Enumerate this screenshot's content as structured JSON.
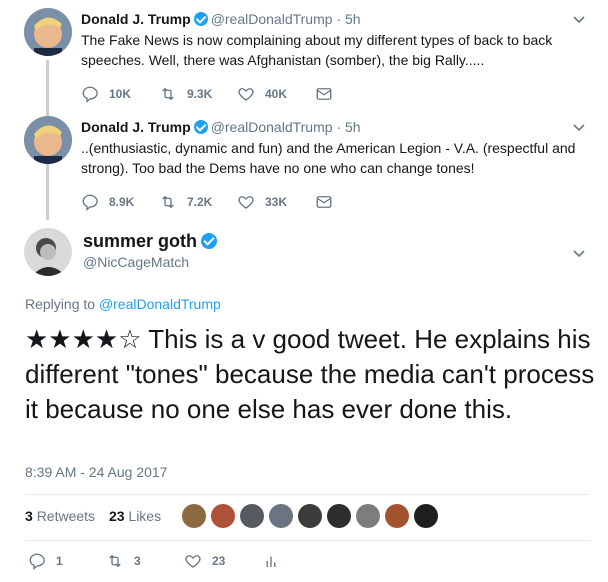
{
  "tweets": [
    {
      "name": "Donald J. Trump",
      "handle": "@realDonaldTrump",
      "time": "· 5h",
      "text": "The Fake News is now complaining about my different types of back to back speeches. Well, there was Afghanistan (somber), the big Rally.....",
      "replies": "10K",
      "retweets": "9.3K",
      "likes": "40K"
    },
    {
      "name": "Donald J. Trump",
      "handle": "@realDonaldTrump",
      "time": "· 5h",
      "text": "..(enthusiastic, dynamic and fun) and the American Legion - V.A. (respectful and strong). Too bad the Dems have no one who can change tones!",
      "replies": "8.9K",
      "retweets": "7.2K",
      "likes": "33K"
    }
  ],
  "main": {
    "name": "summer goth",
    "handle": "@NicCageMatch",
    "replying_prefix": "Replying to ",
    "replying_to": "@realDonaldTrump",
    "text": "★★★★☆ This is a v good tweet. He explains his different \"tones\" because the media can't process it because no one else has ever done this.",
    "timestamp": "8:39 AM - 24 Aug 2017",
    "retweet_count": "3",
    "retweet_label": "Retweets",
    "like_count": "23",
    "like_label": "Likes",
    "replies": "1",
    "retweets": "3",
    "likes": "23"
  },
  "colors": {
    "accent": "#1da1f2",
    "muted": "#657786",
    "text": "#14171a"
  },
  "icons": [
    "reply-icon",
    "retweet-icon",
    "like-icon",
    "message-icon",
    "analytics-icon",
    "chevron-down-icon",
    "verified-badge-icon"
  ]
}
